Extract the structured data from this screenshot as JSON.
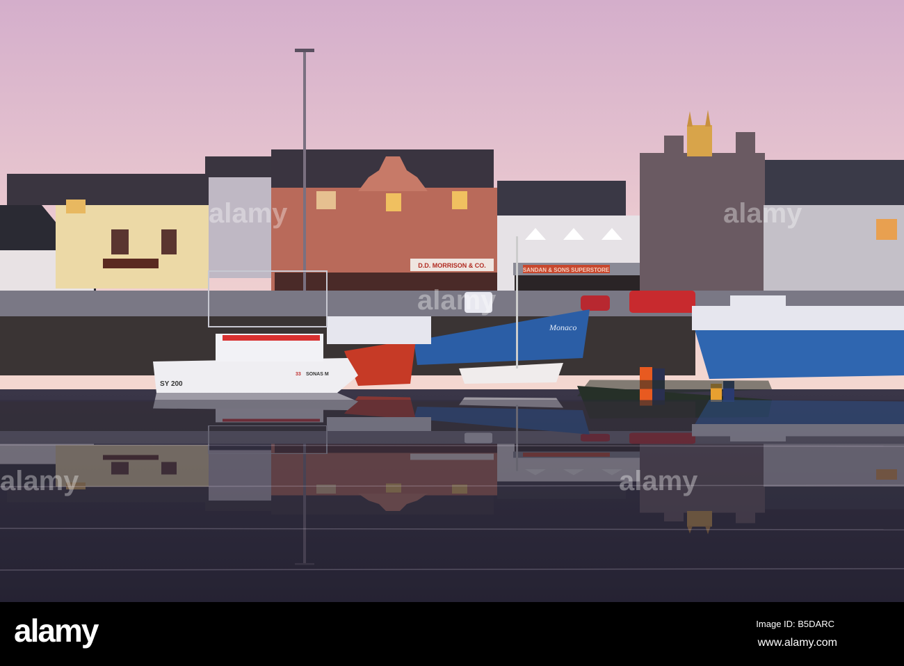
{
  "photo": {
    "signs": {
      "morrison": "D.D. MORRISON & CO.",
      "superstore": "SANDAN & SONS SUPERSTORE",
      "boat_reg": "SY 200",
      "boat_name_hull": "SONAS M",
      "boat_number": "33",
      "blue_boat_name": "Monaco"
    },
    "watermark": "alamy",
    "colors": {
      "sky_top": "#d7b2c9",
      "sky_bottom": "#f2d3cf",
      "water": "#2e2c3c",
      "red_boat": "#c63a26",
      "blue_boat": "#2f66b0"
    }
  },
  "footer": {
    "logo": "alamy",
    "image_id": "Image ID: B5DARC",
    "website": "www.alamy.com"
  }
}
